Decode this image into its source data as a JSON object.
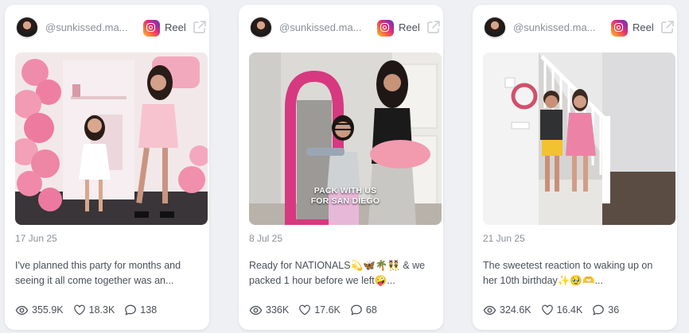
{
  "posts": [
    {
      "handle": "@sunkissed.ma...",
      "type": "Reel",
      "date": "17 Jun 25",
      "caption_line1": "I've planned this party for months and",
      "caption_line2": "seeing it all come together was an...",
      "overlay_text": "",
      "views": "355.9K",
      "likes": "18.3K",
      "comments": "138"
    },
    {
      "handle": "@sunkissed.ma...",
      "type": "Reel",
      "date": "8 Jul 25",
      "caption_line1": "Ready for NATIONALS💫🦋🌴👯 & we",
      "caption_line2": "packed 1 hour before we left🤪...",
      "overlay_text": "PACK WITH US\nFOR SAN DIEGO",
      "views": "336K",
      "likes": "17.6K",
      "comments": "68"
    },
    {
      "handle": "@sunkissed.ma...",
      "type": "Reel",
      "date": "21 Jun 25",
      "caption_line1": "The sweetest reaction to waking up on",
      "caption_line2": "her 10th birthday✨🥹🫶...",
      "overlay_text": "",
      "views": "324.6K",
      "likes": "16.4K",
      "comments": "36"
    }
  ],
  "icons": {
    "platform": "instagram-icon",
    "external": "external-link-icon",
    "views": "eye-icon",
    "likes": "heart-icon",
    "comments": "comment-icon"
  },
  "colors": {
    "background": "#eef0f3",
    "card": "#ffffff",
    "muted_text": "#8a9099",
    "body_text": "#4a4f58"
  }
}
